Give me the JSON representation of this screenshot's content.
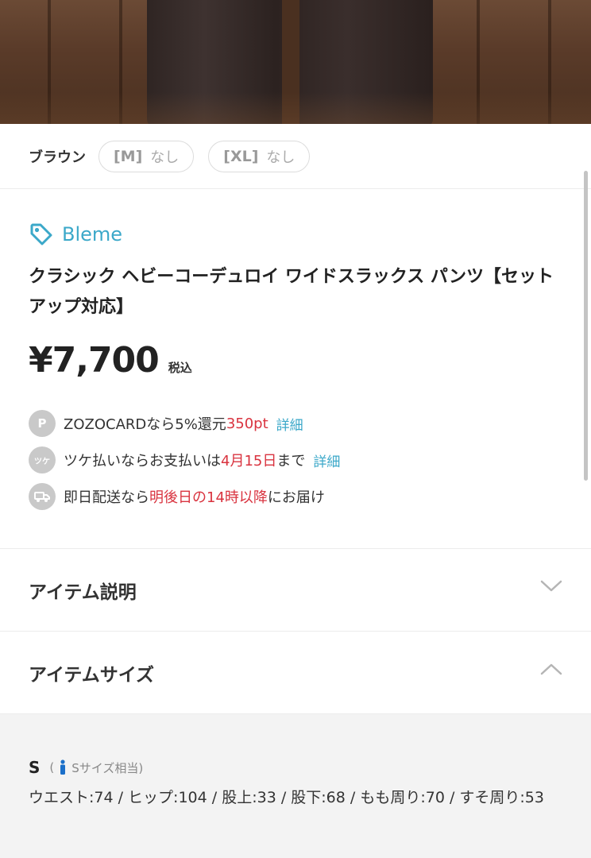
{
  "variants": {
    "color": "ブラウン",
    "sizes": [
      {
        "size": "[M]",
        "stock": "なし"
      },
      {
        "size": "[XL]",
        "stock": "なし"
      }
    ]
  },
  "product": {
    "brand": "Bleme",
    "title": "クラシック ヘビーコーデュロイ ワイドスラックス パンツ【セットアップ対応】",
    "price": "¥7,700",
    "tax_label": "税込"
  },
  "benefits": {
    "zozocard": {
      "icon": "P",
      "text_before": "ZOZOCARDなら5%還元 ",
      "points": "350pt",
      "link": "詳細"
    },
    "tsuke": {
      "icon": "ツケ",
      "text_before": "ツケ払いならお支払いは",
      "date": "4月15日",
      "text_after": "まで",
      "link": "詳細"
    },
    "delivery": {
      "icon": "truck-icon",
      "text_before": "即日配送なら",
      "highlight": "明後日の14時以降",
      "text_after": "にお届け"
    }
  },
  "sections": {
    "description": {
      "label": "アイテム説明"
    },
    "size": {
      "label": "アイテムサイズ"
    }
  },
  "size_info": {
    "name": "S",
    "open_paren": "(",
    "hint": "Sサイズ相当)",
    "detail": "ウエスト:74 / ヒップ:104 / 股上:33 / 股下:68 / もも周り:70 / すそ周り:53"
  },
  "colors": {
    "accent": "#3ba8c9",
    "highlight": "#d9333f"
  }
}
